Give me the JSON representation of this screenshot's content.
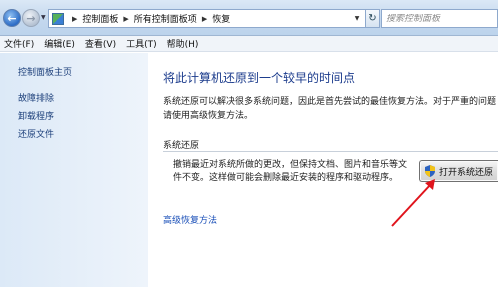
{
  "address": {
    "crumbs": [
      "控制面板",
      "所有控制面板项",
      "恢复"
    ],
    "search_placeholder": "搜索控制面板"
  },
  "menu": {
    "items": [
      "文件(F)",
      "编辑(E)",
      "查看(V)",
      "工具(T)",
      "帮助(H)"
    ]
  },
  "sidebar": {
    "items": [
      {
        "label": "控制面板主页"
      },
      {
        "label": "故障排除"
      },
      {
        "label": "卸载程序"
      },
      {
        "label": "还原文件"
      }
    ]
  },
  "main": {
    "title": "将此计算机还原到一个较早的时间点",
    "desc_line1": "系统还原可以解决很多系统问题，因此是首先尝试的最佳恢复方法。对于严重的问题",
    "desc_line2": "请使用高级恢复方法。",
    "section_label": "系统还原",
    "restore_text": "撤销最近对系统所做的更改，但保持文档、图片和音乐等文件不变。这样做可能会删除最近安装的程序和驱动程序。",
    "restore_button": "打开系统还原",
    "advanced_link": "高级恢复方法"
  },
  "colors": {
    "link": "#1c3f7a",
    "title": "#1b3b8c",
    "annotation": "#e0141c"
  }
}
